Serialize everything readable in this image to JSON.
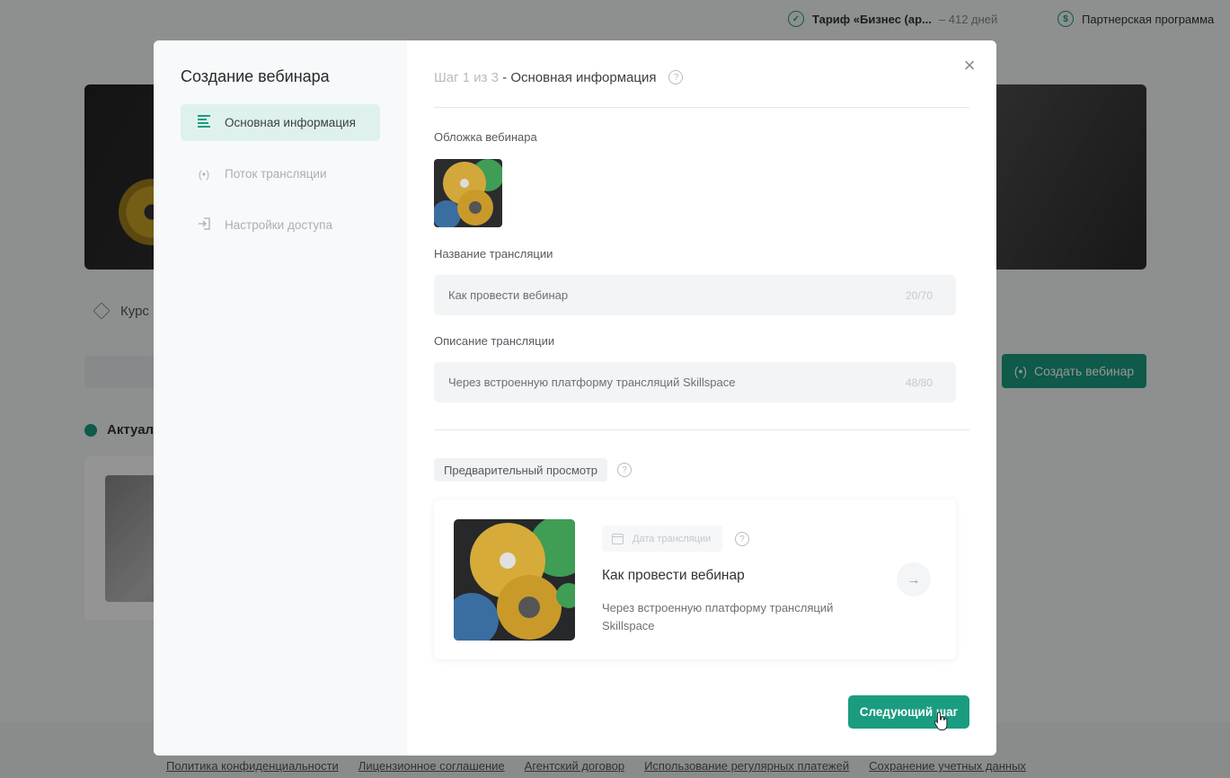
{
  "background": {
    "tariff": {
      "name": "Тариф «Бизнес (ар...",
      "days": "– 412 дней"
    },
    "partner_program": "Партнерская программа",
    "courses_label": "Курс",
    "create_webinar_button": "Создать вебинар",
    "actual_label": "Актуал",
    "footer_links": [
      "Политика конфиденциальности",
      "Лицензионное соглашение",
      "Агентский договор",
      "Использование регулярных платежей",
      "Сохранение учетных данных"
    ]
  },
  "modal": {
    "title": "Создание вебинара",
    "nav": [
      {
        "label": "Основная информация",
        "icon": "text-lines-icon",
        "active": true
      },
      {
        "label": "Поток трансляции",
        "icon": "broadcast-icon",
        "active": false
      },
      {
        "label": "Настройки доступа",
        "icon": "login-icon",
        "active": false
      }
    ],
    "step": {
      "number": "Шаг 1 из 3",
      "separator": " - ",
      "name": "Основная информация"
    },
    "cover_label": "Обложка вебинара",
    "name_field": {
      "label": "Название трансляции",
      "value": "Как провести вебинар",
      "counter": "20/70"
    },
    "description_field": {
      "label": "Описание трансляции",
      "value": "Через встроенную платформу трансляций Skillspace",
      "counter": "48/80"
    },
    "preview": {
      "tag": "Предварительный просмотр",
      "date_chip": "Дата трансляции",
      "title": "Как провести вебинар",
      "description": "Через встроенную платформу трансляций Skillspace"
    },
    "next_button": "Следующий шаг"
  },
  "colors": {
    "accent": "#1a9c80",
    "active_nav_bg": "#dff1ec"
  }
}
